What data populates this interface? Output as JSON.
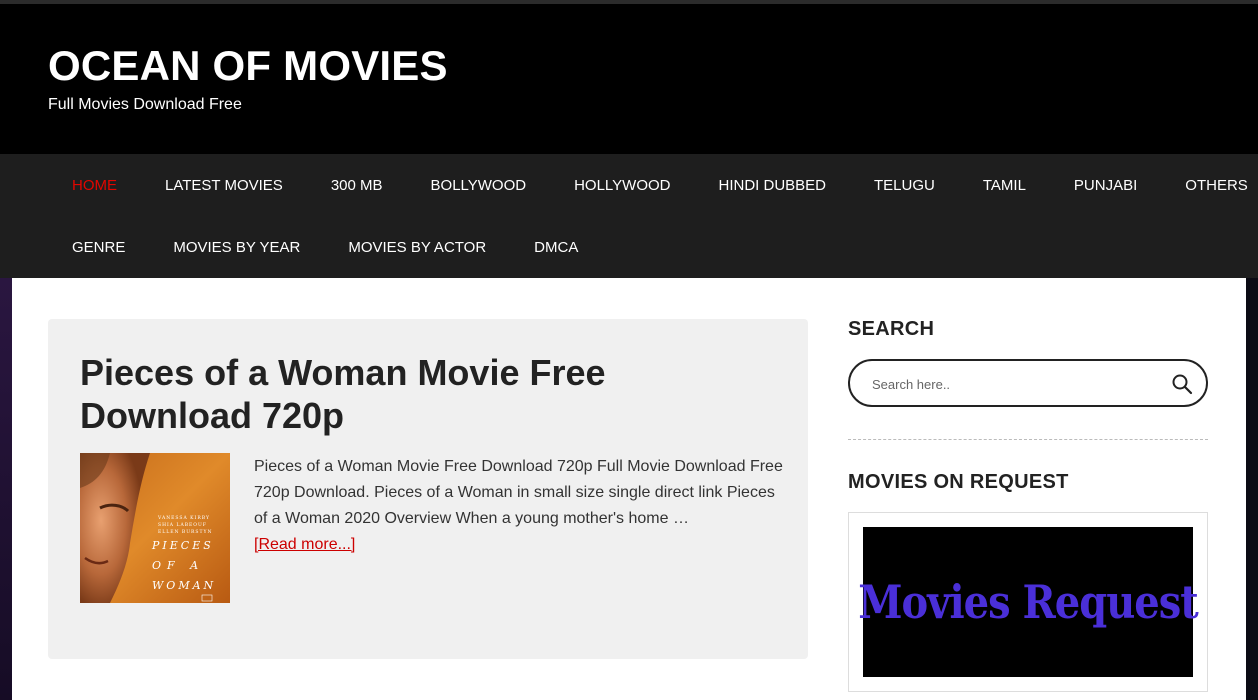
{
  "site": {
    "title": "OCEAN OF MOVIES",
    "tagline": "Full Movies Download Free"
  },
  "nav": {
    "row1": [
      {
        "label": "HOME",
        "active": true
      },
      {
        "label": "LATEST MOVIES"
      },
      {
        "label": "300 MB"
      },
      {
        "label": "BOLLYWOOD"
      },
      {
        "label": "HOLLYWOOD"
      },
      {
        "label": "HINDI DUBBED"
      },
      {
        "label": "TELUGU"
      },
      {
        "label": "TAMIL"
      },
      {
        "label": "PUNJABI"
      },
      {
        "label": "OTHERS"
      }
    ],
    "row2": [
      {
        "label": "GENRE"
      },
      {
        "label": "MOVIES BY YEAR"
      },
      {
        "label": "MOVIES BY ACTOR"
      },
      {
        "label": "DMCA"
      }
    ]
  },
  "post": {
    "title": "Pieces of a Woman Movie Free Download 720p",
    "excerpt": "Pieces of a Woman Movie Free Download 720p Full Movie Download Free 720p Download. Pieces of a Woman in small size single direct link Pieces of a Woman 2020 Overview When a young mother's home …",
    "read_more": "[Read more...]",
    "poster": {
      "cast": [
        "VANESSA KIRBY",
        "SHIA LABEOUF",
        "ELLEN BURSTYN"
      ],
      "title_lines": [
        "PIECES",
        "OF A",
        "WOMAN"
      ]
    }
  },
  "sidebar": {
    "search_title": "SEARCH",
    "search_placeholder": "Search here..",
    "request_title": "MOVIES ON REQUEST",
    "request_banner": "Movies Request"
  },
  "colors": {
    "accent": "#e10600",
    "nav_bg": "#1e1e1e",
    "header_bg": "#000000",
    "banner_text": "#4a2fd8"
  }
}
